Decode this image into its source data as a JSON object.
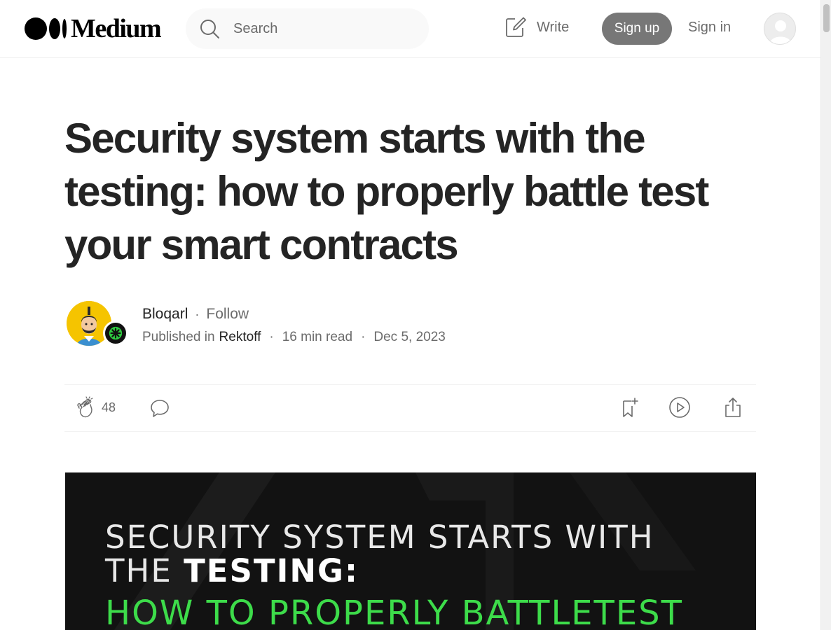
{
  "header": {
    "logo_text": "Medium",
    "search_placeholder": "Search",
    "write_label": "Write",
    "signup_label": "Sign up",
    "signin_label": "Sign in"
  },
  "article": {
    "title": "Security system starts with the testing: how to properly battle test your smart contracts",
    "author": "Bloqarl",
    "follow_label": "Follow",
    "published_in_label": "Published in",
    "publication": "Rektoff",
    "read_time": "16 min read",
    "date": "Dec 5, 2023",
    "dot": "·"
  },
  "actions": {
    "clap_count": "48"
  },
  "hero": {
    "line1": "SECURITY SYSTEM STARTS WITH",
    "line2_prefix": "THE ",
    "line2_bold": "TESTING:",
    "line3": "HOW TO PROPERLY BATTLETEST",
    "accent_color": "#3ddc4a"
  },
  "colors": {
    "button_bg": "#777777",
    "muted_text": "#6b6b6b",
    "text": "#242424"
  }
}
